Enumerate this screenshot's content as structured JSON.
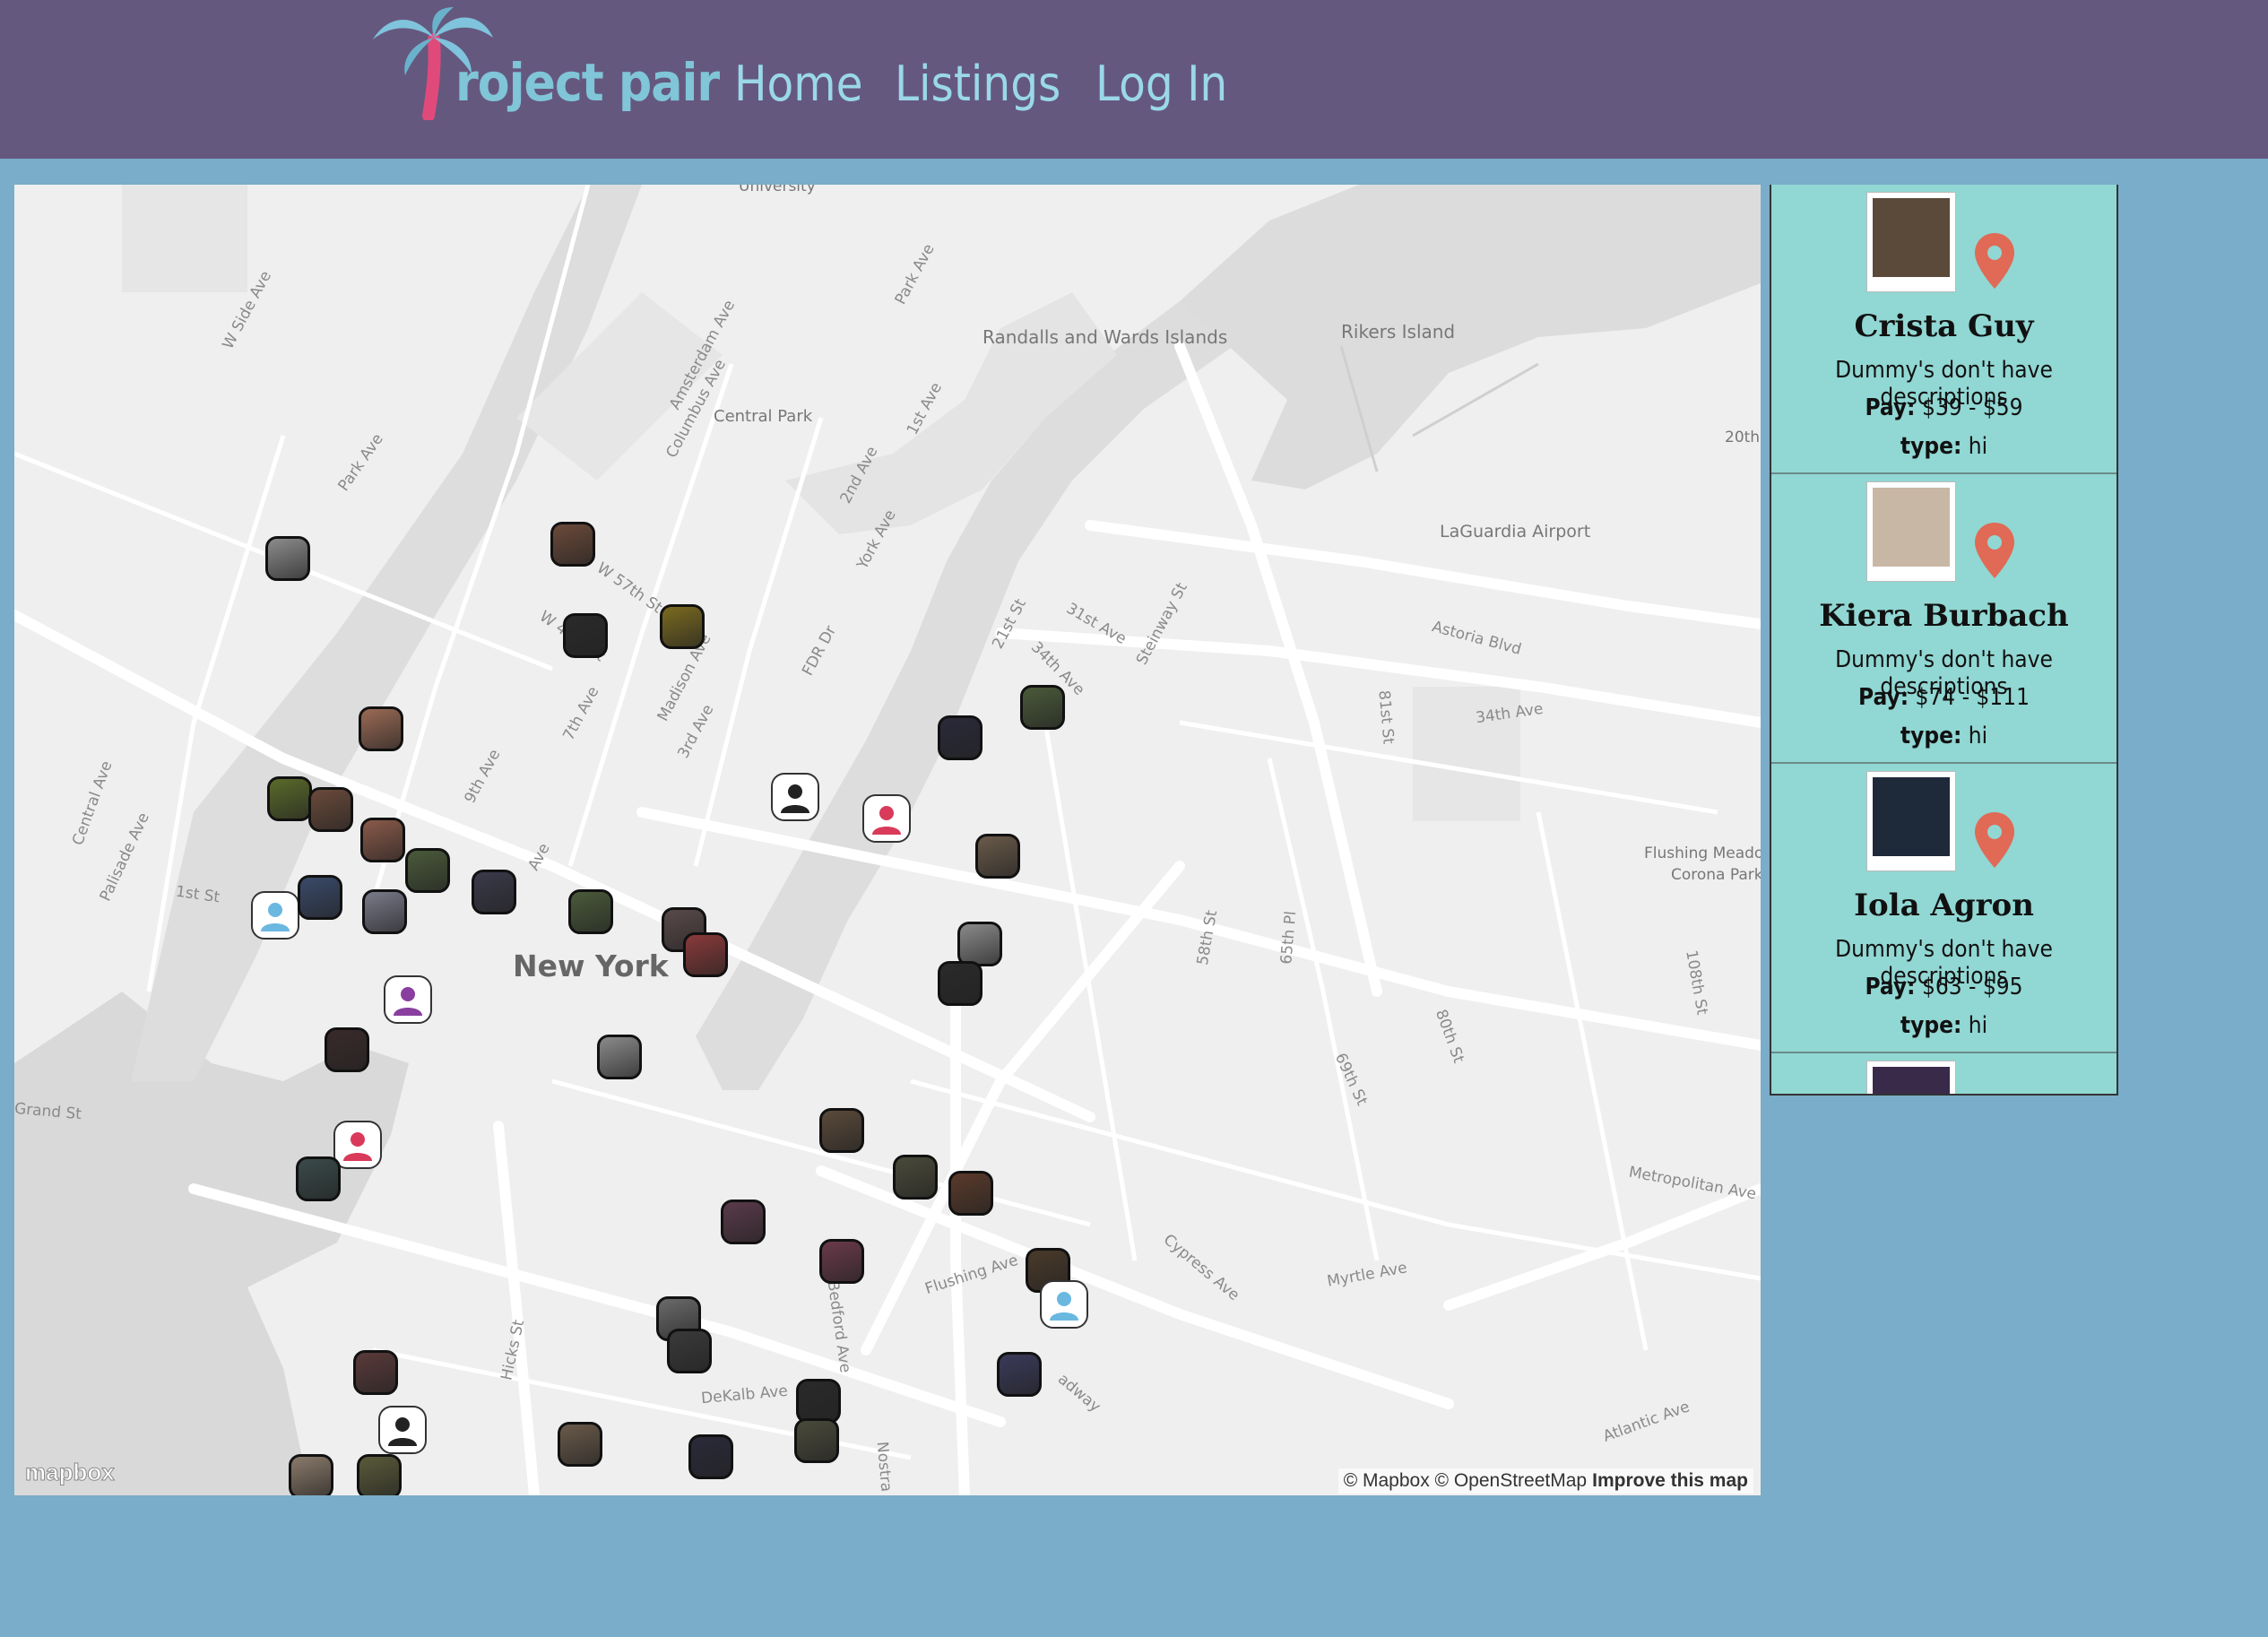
{
  "header": {
    "logo_text": "roject pair",
    "nav": [
      {
        "label": "Home"
      },
      {
        "label": "Listings"
      },
      {
        "label": "Log In"
      }
    ]
  },
  "map": {
    "city_label": "New York",
    "labels": [
      "Randalls and Wards Islands",
      "Rikers Island",
      "Central Park",
      "LaGuardia Airport",
      "Flushing Meado",
      "Corona Park",
      "University",
      "20th"
    ],
    "streets": [
      "W Side Ave",
      "Park Ave",
      "Amsterdam Ave",
      "Columbus Ave",
      "Park Ave",
      "1st Ave",
      "2nd Ave",
      "York Ave",
      "W 57th St",
      "W 42th St",
      "Madison Ave",
      "7th Ave",
      "3rd Ave",
      "FDR Dr",
      "21st St",
      "31st Ave",
      "34th Ave",
      "Steinway St",
      "Astoria Blvd",
      "34th Ave",
      "81st St",
      "Central Ave",
      "Palisade Ave",
      "1st St",
      "9th Ave",
      "Ave",
      "58th St",
      "65th Pl",
      "108th St",
      "80th St",
      "69th St",
      "Grand St",
      "Metropolitan Ave",
      "Cypress Ave",
      "Myrtle Ave",
      "Flushing Ave",
      "Bedford Ave",
      "Hicks St",
      "DeKalb Ave",
      "Atlantic Ave",
      "adway",
      "Nostra"
    ],
    "attribution_text": "© Mapbox © OpenStreetMap",
    "improve_link": "Improve this map",
    "mapbox_logo": "mapbox",
    "markers": [
      {
        "kind": "photo",
        "color": "#8c8c8c"
      },
      {
        "kind": "photo",
        "color": "#6b4a3a"
      },
      {
        "kind": "photo",
        "color": "#2a2a2a"
      },
      {
        "kind": "photo",
        "color": "#7a6a20"
      },
      {
        "kind": "photo",
        "color": "#9a6a55"
      },
      {
        "kind": "photo",
        "color": "#5a6a2a"
      },
      {
        "kind": "photo",
        "color": "#6a4a3a"
      },
      {
        "kind": "photo",
        "color": "#8a5a4a"
      },
      {
        "kind": "photo",
        "color": "#4a5a3a"
      },
      {
        "kind": "default",
        "color": "#6ab8e0"
      },
      {
        "kind": "photo",
        "color": "#3a4a6a"
      },
      {
        "kind": "photo",
        "color": "#7a7a8a"
      },
      {
        "kind": "photo",
        "color": "#3a3a4a"
      },
      {
        "kind": "photo",
        "color": "#4a5a3a"
      },
      {
        "kind": "photo",
        "color": "#5a4a4a"
      },
      {
        "kind": "photo",
        "color": "#8a3a3a"
      },
      {
        "kind": "default",
        "color": "#8a3fa0"
      },
      {
        "kind": "photo",
        "color": "#3a2a2a"
      },
      {
        "kind": "photo",
        "color": "#8a8a8a"
      },
      {
        "kind": "default",
        "color": "#d93a5a"
      },
      {
        "kind": "photo",
        "color": "#3a4a4a"
      },
      {
        "kind": "default",
        "color": "#222222"
      },
      {
        "kind": "default",
        "color": "#d93a5a"
      },
      {
        "kind": "photo",
        "color": "#2a2a3a"
      },
      {
        "kind": "photo",
        "color": "#4a5a3a"
      },
      {
        "kind": "photo",
        "color": "#6a5a4a"
      },
      {
        "kind": "photo",
        "color": "#8a8a8a"
      },
      {
        "kind": "photo",
        "color": "#2a2a2a"
      },
      {
        "kind": "photo",
        "color": "#5a4a3a"
      },
      {
        "kind": "photo",
        "color": "#4a4a3a"
      },
      {
        "kind": "photo",
        "color": "#5a3a2a"
      },
      {
        "kind": "photo",
        "color": "#5a3a4a"
      },
      {
        "kind": "photo",
        "color": "#6a3a4a"
      },
      {
        "kind": "photo",
        "color": "#4a3a2a"
      },
      {
        "kind": "default",
        "color": "#6ab8e0"
      },
      {
        "kind": "photo",
        "color": "#6a6a6a"
      },
      {
        "kind": "photo",
        "color": "#3a3a3a"
      },
      {
        "kind": "photo",
        "color": "#3a3a5a"
      },
      {
        "kind": "photo",
        "color": "#5a3a3a"
      },
      {
        "kind": "default",
        "color": "#222222"
      },
      {
        "kind": "photo",
        "color": "#6a5a4a"
      },
      {
        "kind": "photo",
        "color": "#2a2a3a"
      },
      {
        "kind": "photo",
        "color": "#2a2a2a"
      },
      {
        "kind": "photo",
        "color": "#4a4a3a"
      },
      {
        "kind": "photo",
        "color": "#8a7a6a"
      },
      {
        "kind": "photo",
        "color": "#5a5a3a"
      }
    ]
  },
  "listings": [
    {
      "name": "Crista Guy",
      "description": "Dummy's don't have descriptions",
      "pay_label": "Pay:",
      "pay_value": "$39 - $59",
      "type_label": "type:",
      "type_value": "hi",
      "avatar_color": "#5b4a3a"
    },
    {
      "name": "Kiera Burbach",
      "description": "Dummy's don't have descriptions",
      "pay_label": "Pay:",
      "pay_value": "$74 - $111",
      "type_label": "type:",
      "type_value": "hi",
      "avatar_color": "#c9b7a5"
    },
    {
      "name": "Iola Agron",
      "description": "Dummy's don't have descriptions",
      "pay_label": "Pay:",
      "pay_value": "$63 - $95",
      "type_label": "type:",
      "type_value": "hi",
      "avatar_color": "#1e2a3a"
    }
  ],
  "colors": {
    "header_bg": "#65587f",
    "page_bg": "#79adc9",
    "sidebar_bg": "#91d7d3",
    "pin": "#e06a55",
    "logo_palm": "#e04a7a",
    "logo_text": "#80c5d8"
  }
}
